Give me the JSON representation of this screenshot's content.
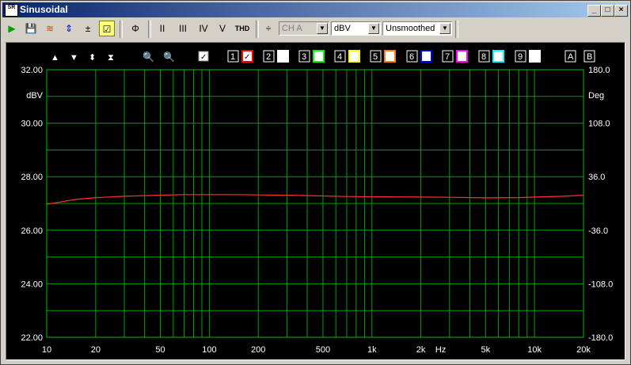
{
  "window": {
    "title": "Sinusoidal",
    "app_icon_text": "SR"
  },
  "toolbar": {
    "buttons": [
      "▶",
      "💾",
      "≋",
      "⇕",
      "±",
      "☑",
      "Φ",
      "II",
      "III",
      "IV",
      "V",
      "THD",
      "÷"
    ],
    "channel_value": "CH A",
    "units_value": "dBV",
    "smoothing_value": "Unsmoothed"
  },
  "plot_toolbar": {
    "traces": [
      "1",
      "2",
      "3",
      "4",
      "5",
      "6",
      "7",
      "8",
      "9"
    ],
    "trace_colors": [
      "#ff0000",
      "#ffffff",
      "#00ff00",
      "#ffff00",
      "#ff8000",
      "#0000ff",
      "#ff00ff",
      "#00ffff",
      "#ffffff"
    ],
    "extra": [
      "A",
      "B"
    ]
  },
  "chart_data": {
    "type": "line",
    "xscale": "log",
    "xlim": [
      10,
      20000
    ],
    "x_ticks": [
      10,
      20,
      50,
      100,
      200,
      500,
      1000,
      2000,
      5000,
      10000,
      20000
    ],
    "x_tick_labels": [
      "10",
      "20",
      "50",
      "100",
      "200",
      "500",
      "1k",
      "2k",
      "5k",
      "10k",
      "20k"
    ],
    "x_unit": "Hz",
    "ylim_left": [
      22,
      32
    ],
    "y_left_ticks": [
      "22.00",
      "24.00",
      "26.00",
      "28.00",
      "30.00",
      "32.00"
    ],
    "y_left_unit": "dBV",
    "y_right_ticks": [
      "-180.0",
      "-108.0",
      "-36.0",
      "36.0",
      "108.0",
      "180.0"
    ],
    "y_right_unit": "Deg",
    "grid": true,
    "series": [
      {
        "color": "#ff3030",
        "x": [
          10,
          12,
          15,
          20,
          30,
          50,
          70,
          100,
          150,
          200,
          300,
          500,
          700,
          1000,
          2000,
          3000,
          5000,
          8000,
          10000,
          15000,
          20000
        ],
        "y": [
          26.97,
          27.05,
          27.15,
          27.22,
          27.27,
          27.31,
          27.33,
          27.33,
          27.33,
          27.32,
          27.31,
          27.28,
          27.26,
          27.25,
          27.24,
          27.23,
          27.21,
          27.22,
          27.24,
          27.27,
          27.31
        ]
      }
    ]
  }
}
